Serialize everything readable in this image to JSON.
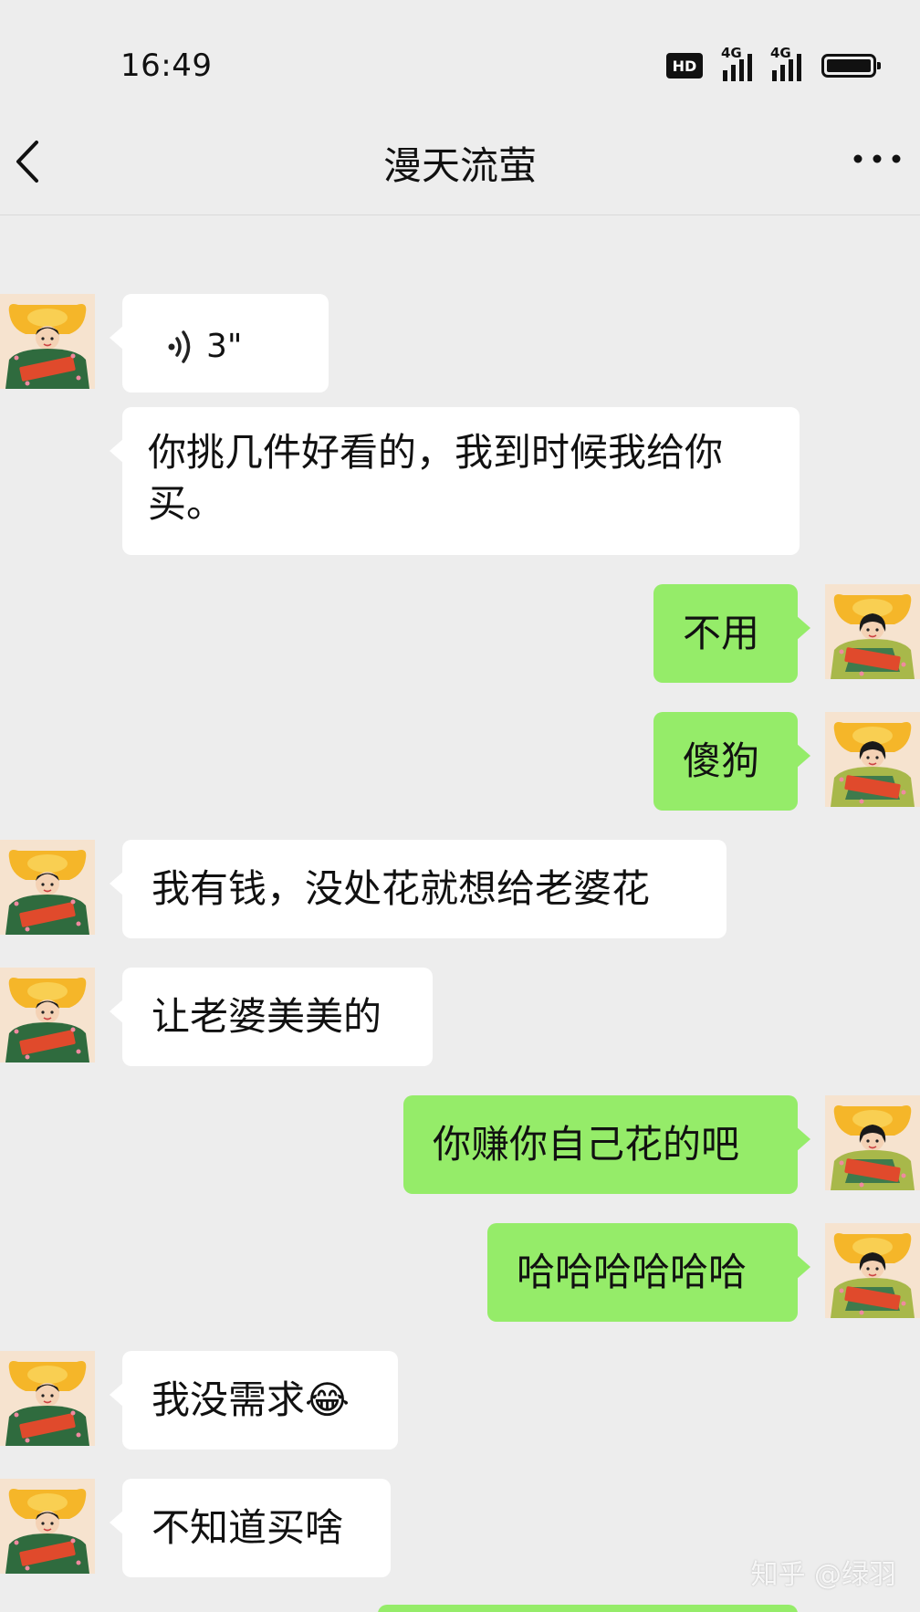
{
  "status": {
    "time": "16:49",
    "hd_label": "HD",
    "sim1_network": "4G",
    "sim2_network": "4G",
    "battery_level": 1.0
  },
  "header": {
    "title": "漫天流萤",
    "back_icon": "chevron-left-icon",
    "more_icon": "more-horizontal-icon"
  },
  "messages": [
    {
      "side": "left",
      "type": "voice",
      "duration": "3\""
    },
    {
      "side": "left",
      "type": "text",
      "text": "你挑几件好看的，我到时候我给你买。"
    },
    {
      "side": "right",
      "type": "text",
      "text": "不用"
    },
    {
      "side": "right",
      "type": "text",
      "text": "傻狗"
    },
    {
      "side": "left",
      "type": "text",
      "text": "我有钱，没处花就想给老婆花"
    },
    {
      "side": "left",
      "type": "text",
      "text": "让老婆美美的"
    },
    {
      "side": "right",
      "type": "text",
      "text": "你赚你自己花的吧"
    },
    {
      "side": "right",
      "type": "text",
      "text": "哈哈哈哈哈哈"
    },
    {
      "side": "left",
      "type": "text",
      "text": "我没需求😂"
    },
    {
      "side": "left",
      "type": "text",
      "text": "不知道买啥"
    }
  ],
  "watermark": "知乎 @绿羽",
  "colors": {
    "background": "#ededed",
    "incoming_bubble": "#ffffff",
    "outgoing_bubble": "#95ec69"
  }
}
